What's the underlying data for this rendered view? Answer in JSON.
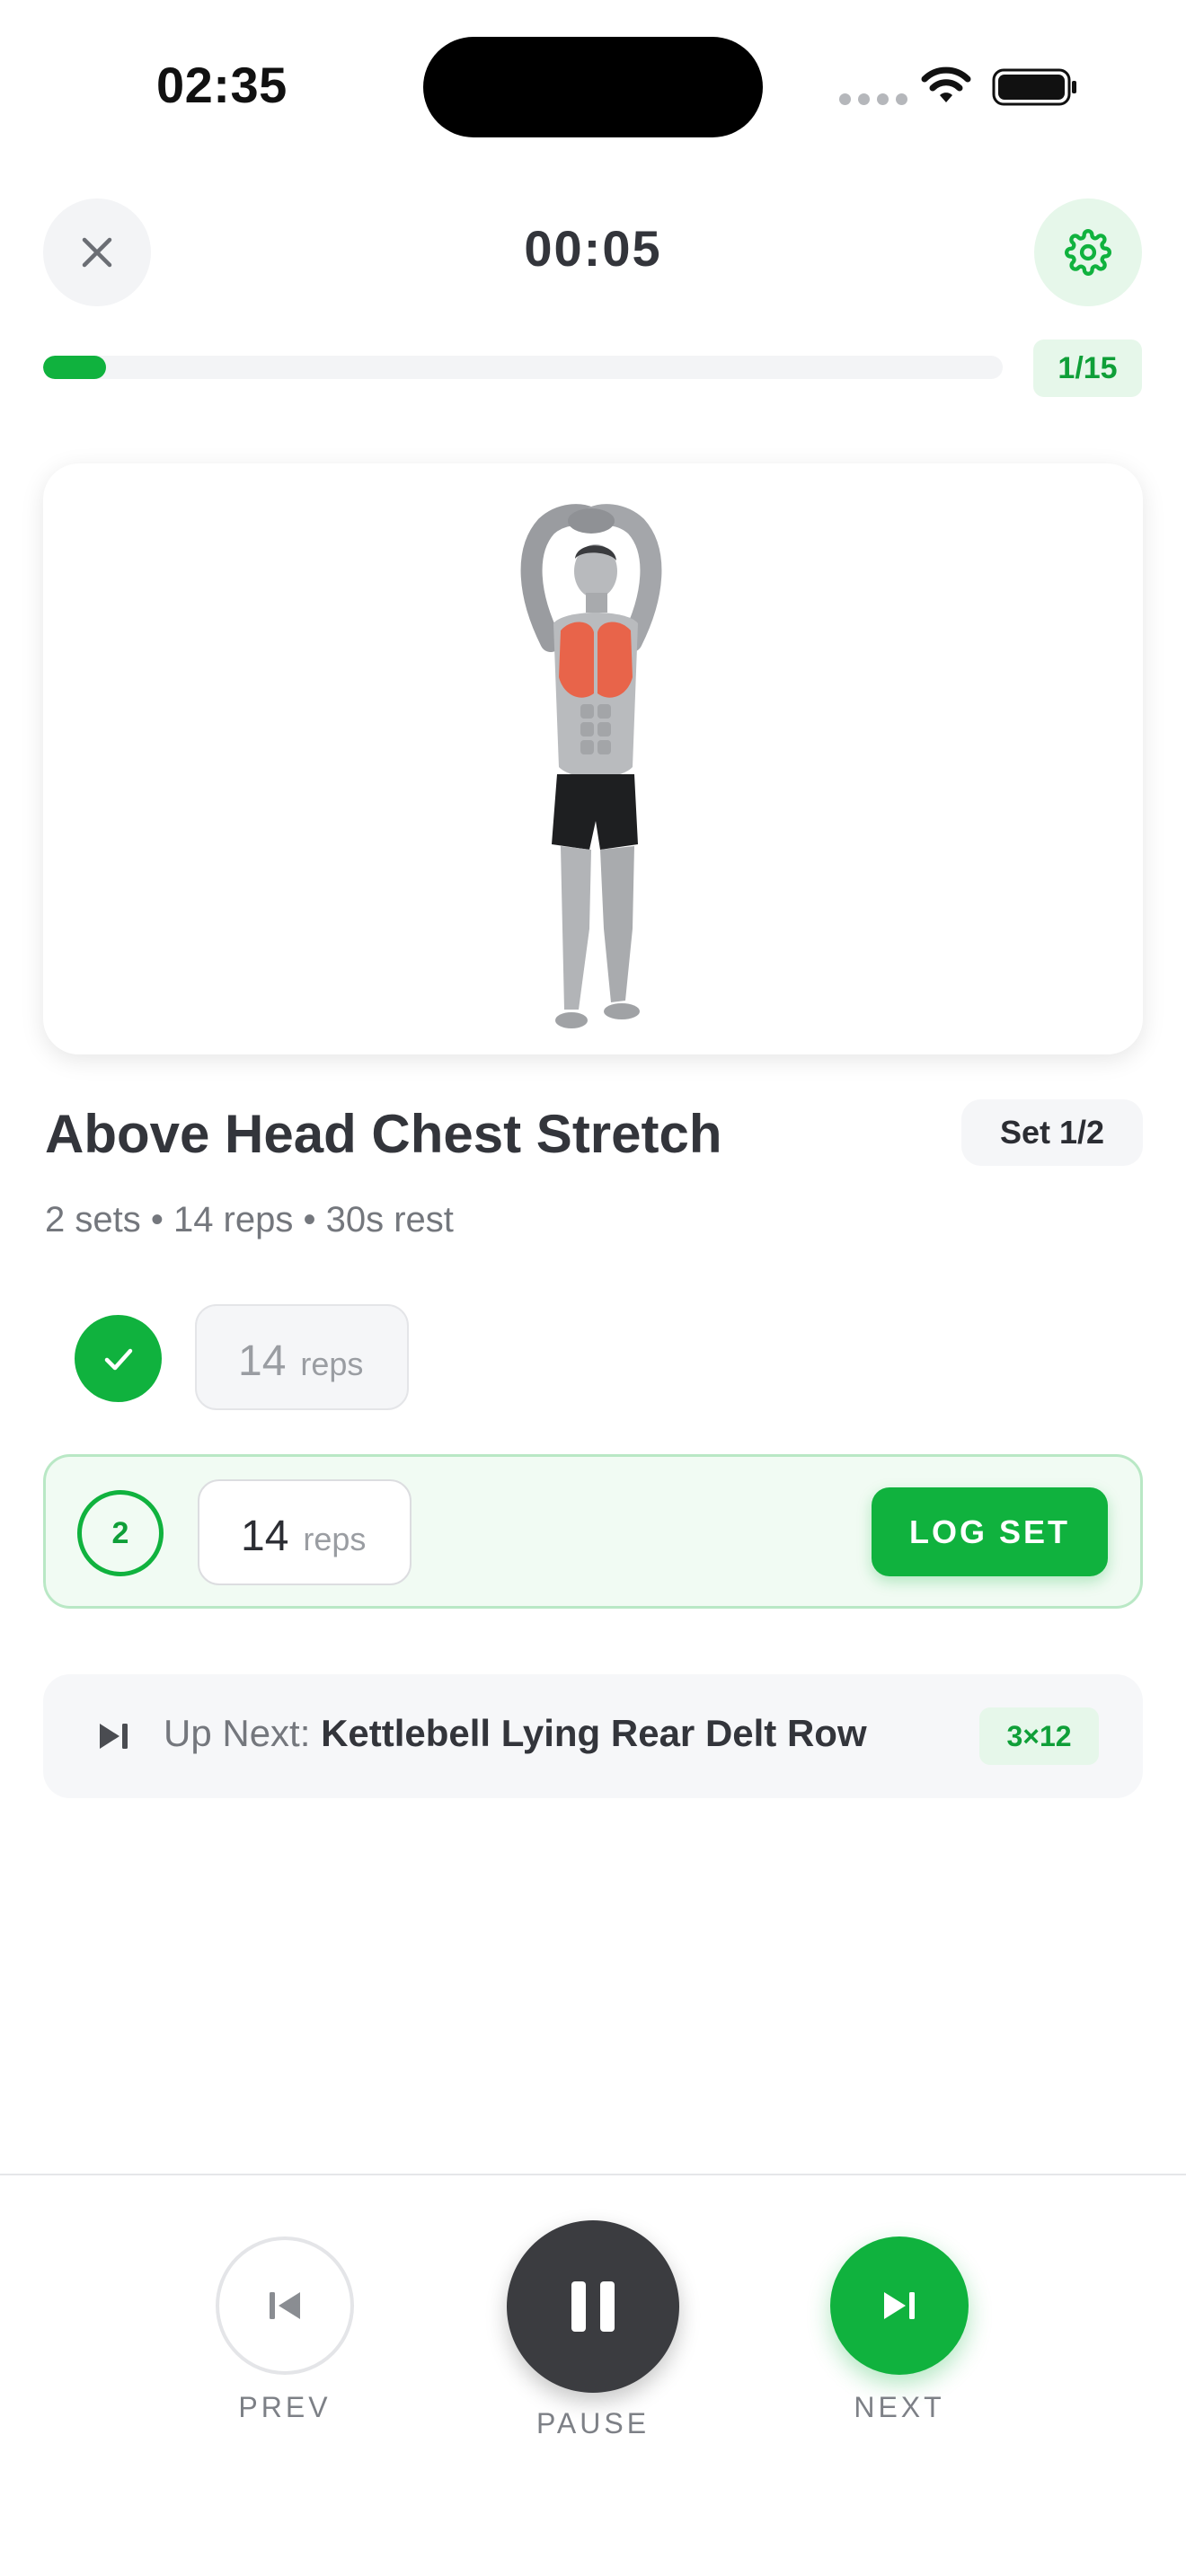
{
  "status_bar": {
    "time": "02:35",
    "icons": [
      "cellular-dots",
      "wifi-icon",
      "battery-icon"
    ]
  },
  "header": {
    "close_icon": "close-icon",
    "timer": "00:05",
    "settings_icon": "gear-icon"
  },
  "progress": {
    "label": "1/15",
    "current": 1,
    "total": 15
  },
  "exercise": {
    "title": "Above Head Chest Stretch",
    "set_badge": "Set 1/2",
    "meta": "2 sets • 14 reps • 30s rest",
    "sets": [
      {
        "number": "1",
        "reps": "14",
        "unit": "reps",
        "status": "done"
      },
      {
        "number": "2",
        "reps": "14",
        "unit": "reps",
        "status": "active"
      }
    ],
    "log_button": "LOG SET"
  },
  "up_next": {
    "prefix": "Up Next: ",
    "name": "Kettlebell Lying Rear Delt Row",
    "badge": "3×12"
  },
  "controls": {
    "prev_label": "PREV",
    "pause_label": "PAUSE",
    "next_label": "NEXT"
  },
  "colors": {
    "accent": "#10b23e",
    "accent_light": "#e6f7ea",
    "dark_button": "#3b3c40",
    "muscle_highlight": "#e8644a"
  }
}
